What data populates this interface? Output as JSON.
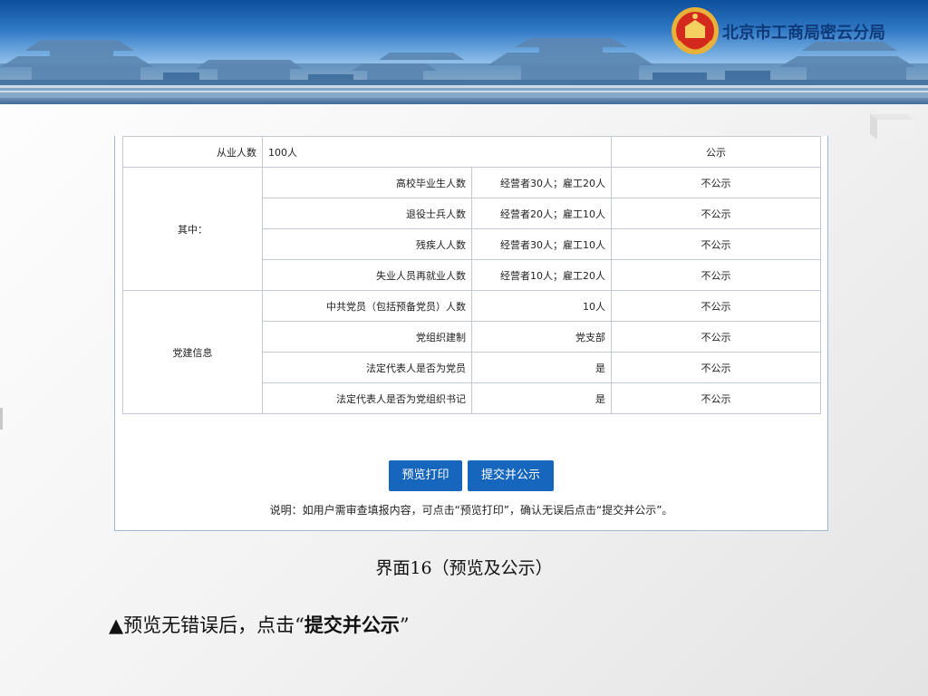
{
  "header": {
    "agency_name": "北京市工商局密云分局",
    "emblem_icon": "national-emblem-icon",
    "colors": {
      "banner_top": "#0c4f9c",
      "banner_bottom": "#e8f1f9",
      "agency_text": "#0f3a7a"
    }
  },
  "table": {
    "employees": {
      "label": "从业人数",
      "value": "100人",
      "status": "公示"
    },
    "among": {
      "label": "其中：",
      "rows": [
        {
          "label": "高校毕业生人数",
          "value": "经营者30人；雇工20人",
          "status": "不公示"
        },
        {
          "label": "退役士兵人数",
          "value": "经营者20人；雇工10人",
          "status": "不公示"
        },
        {
          "label": "残疾人人数",
          "value": "经营者30人；雇工10人",
          "status": "不公示"
        },
        {
          "label": "失业人员再就业人数",
          "value": "经营者10人；雇工20人",
          "status": "不公示"
        }
      ]
    },
    "party": {
      "label": "党建信息",
      "rows": [
        {
          "label": "中共党员（包括预备党员）人数",
          "value": "10人",
          "status": "不公示"
        },
        {
          "label": "党组织建制",
          "value": "党支部",
          "status": "不公示"
        },
        {
          "label": "法定代表人是否为党员",
          "value": "是",
          "status": "不公示"
        },
        {
          "label": "法定代表人是否为党组织书记",
          "value": "是",
          "status": "不公示"
        }
      ]
    }
  },
  "buttons": {
    "preview_label": "预览打印",
    "submit_label": "提交并公示",
    "color": "#1766bd"
  },
  "note": "说明：如用户需审查填报内容，可点击“预览打印”，确认无误后点击“提交并公示”。",
  "caption": "界面16（预览及公示）",
  "instruction": {
    "prefix": "▲预览无错误后，点击“",
    "emphasis": "提交并公示",
    "suffix": "”"
  }
}
